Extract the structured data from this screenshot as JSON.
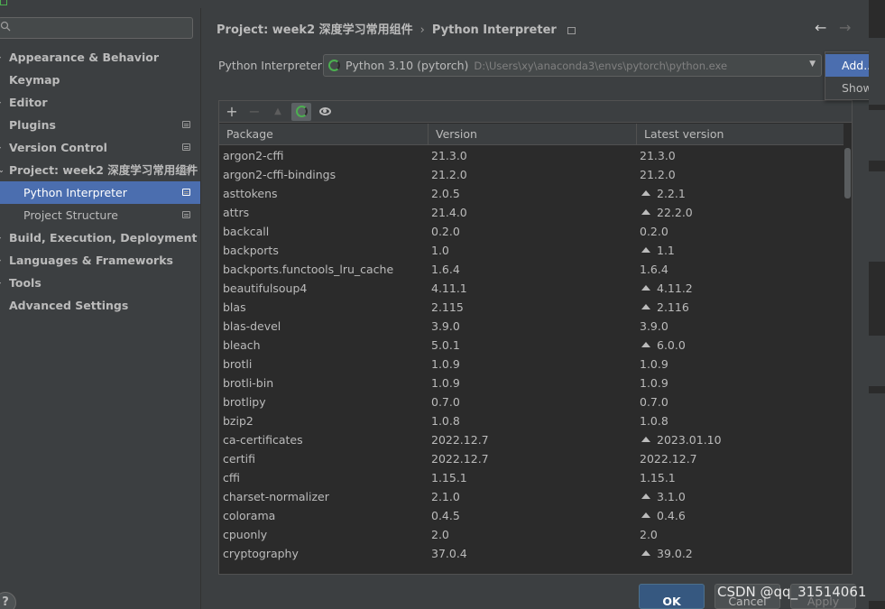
{
  "sidebar": {
    "search_placeholder": "",
    "items": [
      {
        "label": "Appearance & Behavior",
        "arrow": "›"
      },
      {
        "label": "Keymap"
      },
      {
        "label": "Editor",
        "arrow": "›"
      },
      {
        "label": "Plugins"
      },
      {
        "label": "Version Control",
        "arrow": "›"
      },
      {
        "label": "Project: week2 深度学习常用组件",
        "arrow": "⌄"
      },
      {
        "label": "Python Interpreter"
      },
      {
        "label": "Project Structure"
      },
      {
        "label": "Build, Execution, Deployment",
        "arrow": "›"
      },
      {
        "label": "Languages & Frameworks",
        "arrow": "›"
      },
      {
        "label": "Tools",
        "arrow": "›"
      },
      {
        "label": "Advanced Settings"
      }
    ],
    "help_label": "?"
  },
  "breadcrumb": {
    "project": "Project: week2 深度学习常用组件",
    "separator": "›",
    "page": "Python Interpreter"
  },
  "nav": {
    "back": "←",
    "forward": "→"
  },
  "interpreter": {
    "label": "Python Interpreter:",
    "name": "Python 3.10 (pytorch)",
    "path": "D:\\Users\\xy\\anaconda3\\envs\\pytorch\\python.exe",
    "arrow": "▼"
  },
  "popup_menu": {
    "items": [
      "Add...",
      "Show All..."
    ]
  },
  "toolbar": {
    "add": "+",
    "remove": "−",
    "upgrade": "▲"
  },
  "table": {
    "columns": [
      "Package",
      "Version",
      "Latest version"
    ],
    "rows": [
      {
        "package": "argon2-cffi",
        "version": "21.3.0",
        "latest": "21.3.0",
        "upgrade": false
      },
      {
        "package": "argon2-cffi-bindings",
        "version": "21.2.0",
        "latest": "21.2.0",
        "upgrade": false
      },
      {
        "package": "asttokens",
        "version": "2.0.5",
        "latest": "2.2.1",
        "upgrade": true
      },
      {
        "package": "attrs",
        "version": "21.4.0",
        "latest": "22.2.0",
        "upgrade": true
      },
      {
        "package": "backcall",
        "version": "0.2.0",
        "latest": "0.2.0",
        "upgrade": false
      },
      {
        "package": "backports",
        "version": "1.0",
        "latest": "1.1",
        "upgrade": true
      },
      {
        "package": "backports.functools_lru_cache",
        "version": "1.6.4",
        "latest": "1.6.4",
        "upgrade": false
      },
      {
        "package": "beautifulsoup4",
        "version": "4.11.1",
        "latest": "4.11.2",
        "upgrade": true
      },
      {
        "package": "blas",
        "version": "2.115",
        "latest": "2.116",
        "upgrade": true
      },
      {
        "package": "blas-devel",
        "version": "3.9.0",
        "latest": "3.9.0",
        "upgrade": false
      },
      {
        "package": "bleach",
        "version": "5.0.1",
        "latest": "6.0.0",
        "upgrade": true
      },
      {
        "package": "brotli",
        "version": "1.0.9",
        "latest": "1.0.9",
        "upgrade": false
      },
      {
        "package": "brotli-bin",
        "version": "1.0.9",
        "latest": "1.0.9",
        "upgrade": false
      },
      {
        "package": "brotlipy",
        "version": "0.7.0",
        "latest": "0.7.0",
        "upgrade": false
      },
      {
        "package": "bzip2",
        "version": "1.0.8",
        "latest": "1.0.8",
        "upgrade": false
      },
      {
        "package": "ca-certificates",
        "version": "2022.12.7",
        "latest": "2023.01.10",
        "upgrade": true
      },
      {
        "package": "certifi",
        "version": "2022.12.7",
        "latest": "2022.12.7",
        "upgrade": false
      },
      {
        "package": "cffi",
        "version": "1.15.1",
        "latest": "1.15.1",
        "upgrade": false
      },
      {
        "package": "charset-normalizer",
        "version": "2.1.0",
        "latest": "3.1.0",
        "upgrade": true
      },
      {
        "package": "colorama",
        "version": "0.4.5",
        "latest": "0.4.6",
        "upgrade": true
      },
      {
        "package": "cpuonly",
        "version": "2.0",
        "latest": "2.0",
        "upgrade": false
      },
      {
        "package": "cryptography",
        "version": "37.0.4",
        "latest": "39.0.2",
        "upgrade": true
      }
    ]
  },
  "buttons": {
    "ok": "OK",
    "cancel": "Cancel",
    "apply": "Apply"
  },
  "watermark": "CSDN @qq_31514061",
  "colors": {
    "background": "#3c3f41",
    "table_background": "#2b2b2b",
    "selection": "#4b6eaf",
    "ok_button": "#365880",
    "python_icon": "#4caf50"
  }
}
